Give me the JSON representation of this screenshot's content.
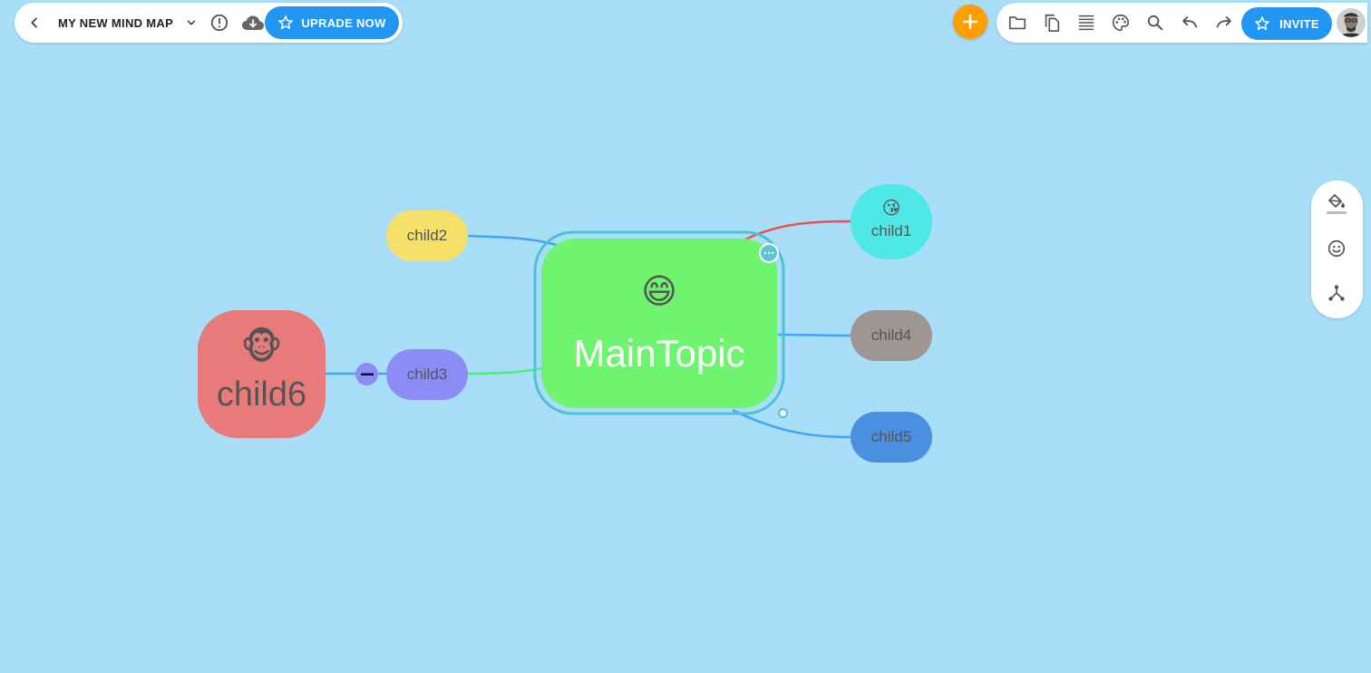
{
  "header": {
    "title": "MY NEW MIND MAP",
    "upgrade_label": "UPRADE NOW",
    "invite_label": "INVITE"
  },
  "icons": {
    "back": "chevron-left-icon",
    "title_menu": "chevron-down-icon",
    "info": "info-icon",
    "cloud": "cloud-download-icon",
    "star": "star-outline-icon",
    "add": "plus-icon",
    "folder": "folder-icon",
    "copy": "copy-icon",
    "outline": "outline-list-icon",
    "palette": "palette-icon",
    "search": "search-icon",
    "undo": "undo-icon",
    "redo": "redo-icon",
    "fill": "paint-bucket-icon",
    "emoji": "smiley-icon",
    "structure": "hierarchy-icon"
  },
  "mindmap": {
    "main": {
      "label": "MainTopic",
      "emoji": "😄",
      "color": "#6ef46e"
    },
    "nodes": [
      {
        "id": "child1",
        "label": "child1",
        "emoji": "😘",
        "color": "#4ee8e6"
      },
      {
        "id": "child2",
        "label": "child2",
        "emoji": "",
        "color": "#f5e06a"
      },
      {
        "id": "child3",
        "label": "child3",
        "emoji": "",
        "color": "#8b8cf5"
      },
      {
        "id": "child4",
        "label": "child4",
        "emoji": "",
        "color": "#9e9595"
      },
      {
        "id": "child5",
        "label": "child5",
        "emoji": "",
        "color": "#4a8fe0"
      },
      {
        "id": "child6",
        "label": "child6",
        "emoji": "🐵",
        "color": "#e87a7a"
      }
    ]
  },
  "colors": {
    "canvas": "#a8def7",
    "accent": "#2196f3",
    "add_button": "#ff9e00",
    "selection": "#4fc1d6"
  }
}
